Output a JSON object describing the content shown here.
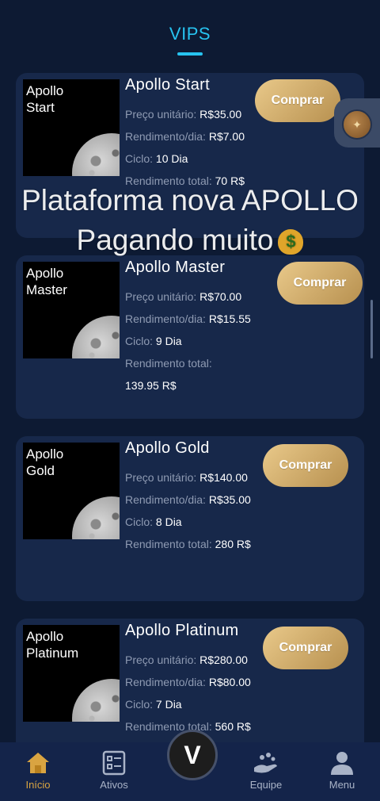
{
  "header": {
    "title": "VIPS"
  },
  "overlay": {
    "line1": "Plataforma nova APOLLO",
    "line2": "Pagando muito",
    "emoji": "money-bag-icon"
  },
  "labels": {
    "price": "Preço unitário:",
    "daily": "Rendimento/dia:",
    "cycle": "Ciclo:",
    "total": "Rendimento total:"
  },
  "plans": [
    {
      "thumb": "Apollo\nStart",
      "name": "Apollo Start",
      "price": "R$35.00",
      "daily": "R$7.00",
      "cycle": "10 Dia",
      "total": "70 R$",
      "button": "Comprar"
    },
    {
      "thumb": "Apollo\nMaster",
      "name": "Apollo Master",
      "price": "R$70.00",
      "daily": "R$15.55",
      "cycle": "9 Dia",
      "total": "139.95 R$",
      "button": "Comprar"
    },
    {
      "thumb": "Apollo\nGold",
      "name": "Apollo Gold",
      "price": "R$140.00",
      "daily": "R$35.00",
      "cycle": "8 Dia",
      "total": "280 R$",
      "button": "Comprar"
    },
    {
      "thumb": "Apollo\nPlatinum",
      "name": "Apollo Platinum",
      "price": "R$280.00",
      "daily": "R$80.00",
      "cycle": "7 Dia",
      "total": "560 R$",
      "button": "Comprar"
    }
  ],
  "nav": {
    "items": [
      {
        "label": "Início",
        "icon": "home-icon",
        "active": true
      },
      {
        "label": "Ativos",
        "icon": "list-icon",
        "active": false
      },
      {
        "label": "Equipe",
        "icon": "team-icon",
        "active": false
      },
      {
        "label": "Menu",
        "icon": "user-icon",
        "active": false
      }
    ],
    "center_logo": "V"
  },
  "colors": {
    "background": "#0d1a33",
    "card": "#17284a",
    "accent": "#27c3f0",
    "gold": "#d4b06a",
    "nav_active": "#d9a441"
  }
}
